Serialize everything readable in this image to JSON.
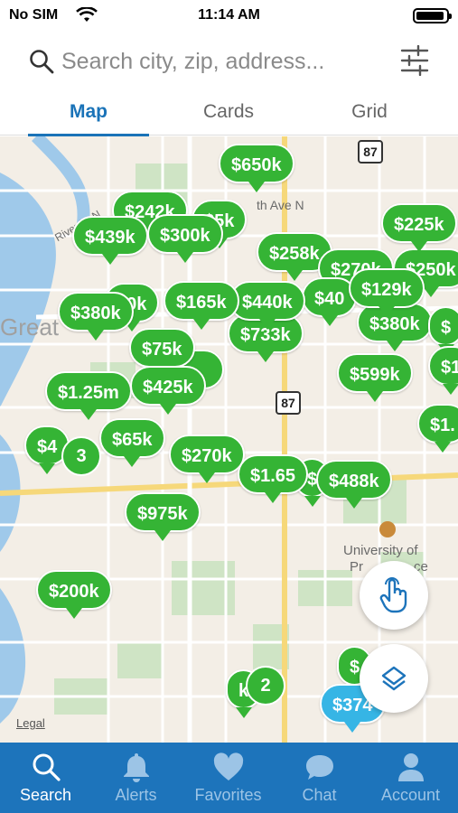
{
  "status": {
    "carrier": "No SIM",
    "time": "11:14 AM"
  },
  "search": {
    "placeholder": "Search city, zip, address..."
  },
  "tabs": [
    {
      "label": "Map",
      "active": true
    },
    {
      "label": "Cards",
      "active": false
    },
    {
      "label": "Grid",
      "active": false
    }
  ],
  "map": {
    "labels": {
      "street_n": "th Ave N",
      "river": "River Dr N",
      "great": "Great",
      "university": "University of",
      "university2": "Pr",
      "university3": "ce",
      "legal": "Legal"
    },
    "routes": [
      "87",
      "87"
    ],
    "pins": [
      "$650k",
      "$242k",
      "$439k",
      "$300k",
      "$5k",
      "$258k",
      "$225k",
      "$250k",
      "$270k",
      "$380k",
      "$0k",
      "$165k",
      "$440k",
      "$40",
      "$129k",
      "$380k",
      "$75k",
      "$733k",
      "$599k",
      "$1.25m",
      "$425k",
      "$4",
      "$65k",
      "$270k",
      "$1.65",
      "$",
      "$488k",
      "$975k",
      "$200k",
      "$",
      "$1",
      "$1.",
      "$",
      "k",
      "$",
      "$"
    ],
    "blue_pin": "$374",
    "clusters": [
      "3",
      "2"
    ]
  },
  "nav": [
    {
      "label": "Search",
      "icon": "search-icon",
      "active": true
    },
    {
      "label": "Alerts",
      "icon": "bell-icon",
      "active": false
    },
    {
      "label": "Favorites",
      "icon": "heart-icon",
      "active": false
    },
    {
      "label": "Chat",
      "icon": "chat-icon",
      "active": false
    },
    {
      "label": "Account",
      "icon": "person-icon",
      "active": false
    }
  ],
  "colors": {
    "brand": "#1d74bb",
    "pin": "#35b435",
    "pin_selected": "#36b5e5",
    "tab_active": "#1a73b8"
  }
}
